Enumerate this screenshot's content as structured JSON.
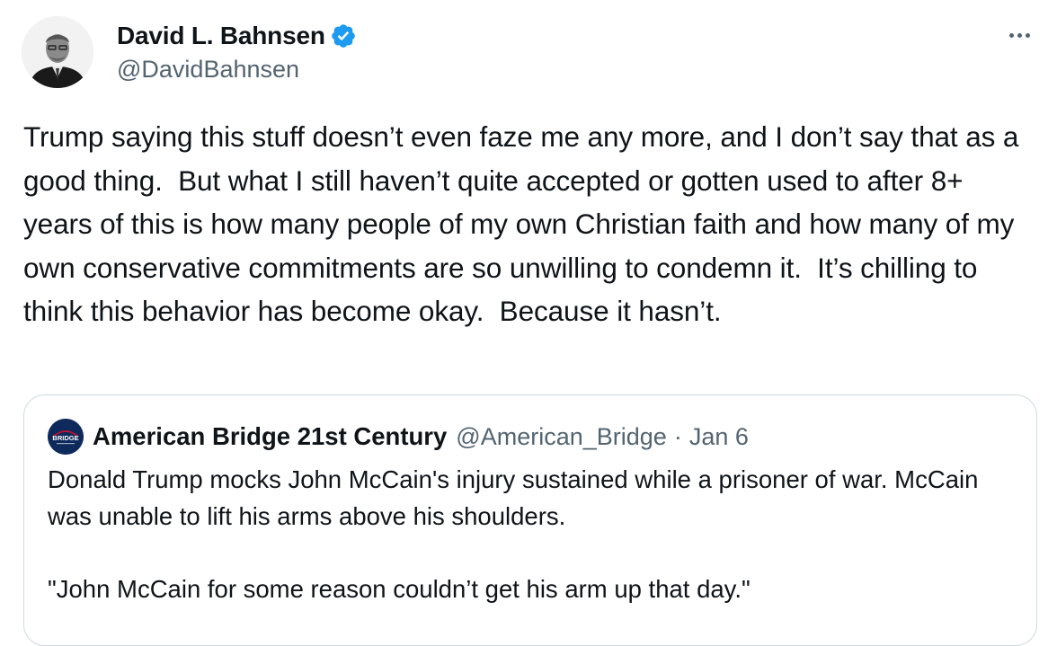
{
  "author": {
    "display_name": "David L. Bahnsen",
    "handle": "@DavidBahnsen",
    "verified_icon": "verified-badge-icon",
    "verified_color": "#1d9bf0"
  },
  "tweet": {
    "text": "Trump saying this stuff doesn’t even faze me any more, and I don’t say that as a good thing.  But what I still haven’t quite accepted or gotten used to after 8+ years of this is how many people of my own Christian faith and how many of my own conservative commitments are so unwilling to condemn it.  It’s chilling to think this behavior has become okay.  Because it hasn’t."
  },
  "quoted": {
    "avatar_text": "BRIDGE",
    "display_name": "American Bridge 21st Century",
    "handle": "@American_Bridge",
    "separator": "·",
    "date": "Jan 6",
    "text": "Donald Trump mocks John McCain's injury sustained while a prisoner of war. McCain was unable to lift his arms above his shoulders.\n\n\"John McCain for some reason couldn’t get his arm up that day.\""
  },
  "colors": {
    "text_primary": "#0f1419",
    "text_secondary": "#536471",
    "border": "#cfd9de"
  }
}
